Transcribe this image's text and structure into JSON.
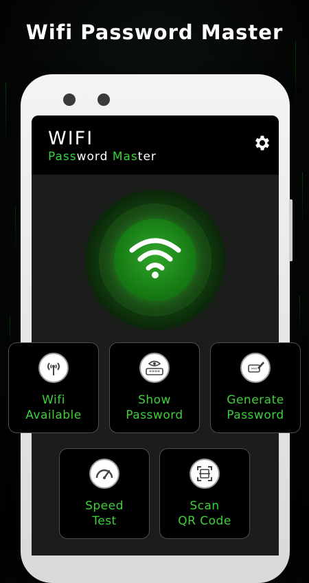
{
  "headline": "Wifi Password Master",
  "app": {
    "title": "WIFI",
    "subtitle_parts": [
      {
        "text": "Pass",
        "accent": true
      },
      {
        "text": "word ",
        "accent": false
      },
      {
        "text": "Mas",
        "accent": true
      },
      {
        "text": "ter",
        "accent": false
      }
    ],
    "settings_icon": "gear-icon"
  },
  "main_button_icon": "wifi-icon",
  "cards": [
    {
      "label": "Wifi\nAvailable",
      "icon": "antenna-icon"
    },
    {
      "label": "Show\nPassword",
      "icon": "password-eye-icon"
    },
    {
      "label": "Generate\nPassword",
      "icon": "password-edit-icon"
    },
    {
      "label": "Speed\nTest",
      "icon": "speedometer-icon"
    },
    {
      "label": "Scan\nQR Code",
      "icon": "qr-scan-icon"
    }
  ],
  "colors": {
    "accent": "#3fd03a",
    "background": "#000000",
    "core": "#177c14"
  }
}
